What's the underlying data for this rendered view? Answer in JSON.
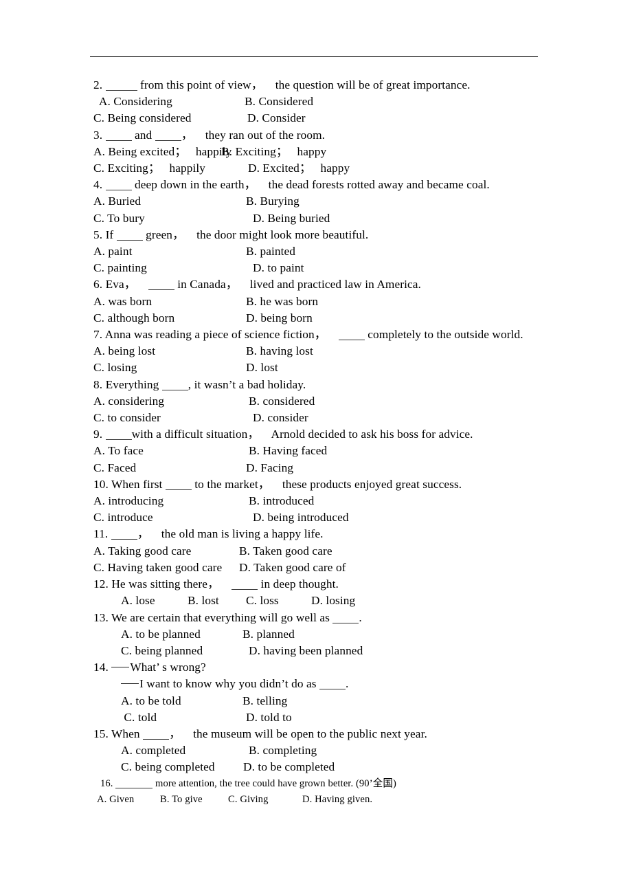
{
  "document": {
    "type": "grammar-worksheet",
    "background_color": "#ffffff",
    "text_color": "#000000",
    "rule": {
      "present": true,
      "color": "#1a1a1a"
    }
  },
  "questions": [
    {
      "number": "2.",
      "stem_before": "2. ",
      "stem_after": " from this point of view，    the question will be of great importance.",
      "stem_full": "2. ____ from this point of view，    the question will be of great importance.",
      "option_a": "A. Considering",
      "option_b": "B. Considered",
      "option_c": "C. Being considered",
      "option_d": "D. Consider"
    },
    {
      "number": "3.",
      "stem_full": "3. ____ and ____，    they ran out of the room.",
      "option_a": "A. Being excited；   happily",
      "option_b": "B. Exciting；   happy",
      "option_c": "C. Exciting；   happily",
      "option_d": "D. Excited；   happy"
    },
    {
      "number": "4.",
      "stem_full": "4. ____ deep down in the earth，    the dead forests rotted away and became coal.",
      "option_a": "A. Buried",
      "option_b": "B. Burying",
      "option_c": "C. To bury",
      "option_d": "D. Being buried"
    },
    {
      "number": "5.",
      "stem_full": "5. If ____ green，    the door might look more beautiful.",
      "option_a": "A. paint",
      "option_b": "B. painted",
      "option_c": "C. painting",
      "option_d": "D. to paint"
    },
    {
      "number": "6.",
      "stem_full": "6. Eva，    ____ in Canada，    lived and practiced law in America.",
      "option_a": "A. was born",
      "option_b": "B. he was born",
      "option_c": "C. although born",
      "option_d": "D. being born"
    },
    {
      "number": "7.",
      "stem_full": "7. Anna was reading a piece of science fiction，    ____ completely to the outside world.",
      "option_a": "A. being lost",
      "option_b": "B. having lost",
      "option_c": "C. losing",
      "option_d": "D. lost"
    },
    {
      "number": "8.",
      "stem_full": "8. Everything ____, it wasn’t a bad holiday.",
      "option_a": "A. considering",
      "option_b": "B. considered",
      "option_c": "C. to consider",
      "option_d": "D. consider"
    },
    {
      "number": "9.",
      "stem_full": "9. ____ with a difficult situation，    Arnold decided to ask his boss for advice.",
      "option_a": "A. To face",
      "option_b": "B. Having faced",
      "option_c": "C. Faced",
      "option_d": "D. Facing"
    },
    {
      "number": "10.",
      "stem_full": "10. When first ____ to the market，    these products enjoyed great success.",
      "option_a": "A. introducing",
      "option_b": "B. introduced",
      "option_c": "C. introduce",
      "option_d": "D. being introduced"
    },
    {
      "number": "11.",
      "stem_full": "11. ____，    the old man is living a happy life.",
      "option_a": "A. Taking good care",
      "option_b": "B. Taken good care",
      "option_c": "C. Having taken good care",
      "option_d": "D. Taken good care of"
    },
    {
      "number": "12.",
      "stem_full": "12. He was sitting there，    ____ in deep thought.",
      "option_a": "A. lose",
      "option_b": "B. lost",
      "option_c": "C. loss",
      "option_d": "D. losing",
      "options_inline": true
    },
    {
      "number": "13.",
      "stem_full": "13. We are certain that everything will go well as ____.",
      "option_a": "A. to be planned",
      "option_b": "B. planned",
      "option_c": "C. being planned",
      "option_d": "D. having been planned"
    },
    {
      "number": "14.",
      "stem_line_1": "14. ——What’ s wrong?",
      "stem_line_2": "——I want to know why you didn’t do as ____.",
      "option_a": "A. to be told",
      "option_b": "B. telling",
      "option_c": "C. told",
      "option_d": "D. told to"
    },
    {
      "number": "15.",
      "stem_full": "15. When ____，    the museum will be open to the public next year.",
      "option_a": "A. completed",
      "option_b": "B. completing",
      "option_c": "C. being completed",
      "option_d": "D. to be completed"
    },
    {
      "number": "16.",
      "stem_full": "16. ______ more attention, the tree could have grown better. (90’全国)",
      "option_a": "A. Given",
      "option_b": "B. To give",
      "option_c": "C. Giving",
      "option_d": "D. Having given.",
      "options_inline": true,
      "small": true
    }
  ],
  "lines": {
    "q2_stem_a": "2. ",
    "q2_stem_b": " from this point of view，    the question will be of great importance.",
    "q2_opts_ab_a": "  A. Considering",
    "q2_opts_ab_b": "B. Considered",
    "q2_opts_cd_c": "C. Being considered",
    "q2_opts_cd_d": "D. Consider",
    "q3_stem_a": "3. ",
    "q3_stem_b": " and ",
    "q3_stem_c": "，    they ran out of the room.",
    "q3_opts_ab_a": "A. Being excited；   happily",
    "q3_opts_ab_b": "B. Exciting；   happy",
    "q3_opts_cd_c": "C. Exciting；   happily",
    "q3_opts_cd_d": "D. Excited；   happy",
    "q4_stem_a": "4. ",
    "q4_stem_b": " deep down in the earth，    the dead forests rotted away and became coal.",
    "q4_opts_ab_a": "A. Buried",
    "q4_opts_ab_b": "B. Burying",
    "q4_opts_cd_c": "C. To bury",
    "q4_opts_cd_d": "D. Being buried",
    "q5_stem_a": "5. If ",
    "q5_stem_b": " green，    the door might look more beautiful.",
    "q5_opts_ab_a": "A. paint",
    "q5_opts_ab_b": "B. painted",
    "q5_opts_cd_c": "C. painting",
    "q5_opts_cd_d": "D. to paint",
    "q6_stem_a": "6. Eva，    ",
    "q6_stem_b": " in Canada，    lived and practiced law in America.",
    "q6_opts_ab_a": "A. was born",
    "q6_opts_ab_b": "B. he was born",
    "q6_opts_cd_c": "C. although born",
    "q6_opts_cd_d": "D. being born",
    "q7_stem_a": "7. Anna was reading a piece of science fiction，    ",
    "q7_stem_b": " completely to the outside world.",
    "q7_opts_ab_a": "A. being lost",
    "q7_opts_ab_b": "B. having lost",
    "q7_opts_cd_c": "C. losing",
    "q7_opts_cd_d": "D. lost",
    "q8_stem_a": "8. Everything ",
    "q8_stem_b": ", it wasn’t a bad holiday.",
    "q8_opts_ab_a": "A. considering",
    "q8_opts_ab_b": "B. considered",
    "q8_opts_cd_c": "C. to consider",
    "q8_opts_cd_d": "D. consider",
    "q9_stem_a": "9. ",
    "q9_stem_b": "with a difficult situation，    Arnold decided to ask his boss for advice.",
    "q9_opts_ab_a": "A. To face",
    "q9_opts_ab_b": "B. Having faced",
    "q9_opts_cd_c": "C. Faced",
    "q9_opts_cd_d": "D. Facing",
    "q10_stem_a": "10. When first ",
    "q10_stem_b": " to the market，    these products enjoyed great success.",
    "q10_opts_ab_a": "A. introducing",
    "q10_opts_ab_b": "B. introduced",
    "q10_opts_cd_c": "C. introduce",
    "q10_opts_cd_d": "D. being introduced",
    "q11_stem_a": "11. ",
    "q11_stem_b": "，    the old man is living a happy life.",
    "q11_opts_ab_a": "A. Taking good care",
    "q11_opts_ab_b": "B. Taken good care",
    "q11_opts_cd_c": "C. Having taken good care",
    "q11_opts_cd_d": "D. Taken good care of",
    "q12_stem_a": "12. He was sitting there，    ",
    "q12_stem_b": " in deep thought.",
    "q12_opt_a": "A. lose",
    "q12_opt_b": "B. lost",
    "q12_opt_c": "C. loss",
    "q12_opt_d": "D. losing",
    "q13_stem_a": "13. We are certain that everything will go well as ",
    "q13_stem_b": ".",
    "q13_opts_ab_a": "A. to be planned",
    "q13_opts_ab_b": "B. planned",
    "q13_opts_cd_c": "C. being planned",
    "q13_opts_cd_d": "D. having been planned",
    "q14_stem_1a": "14. ",
    "q14_stem_1b": "What’ s wrong?",
    "q14_stem_2b": "I want to know why you didn’t do as ",
    "q14_stem_2c": ".",
    "q14_opts_ab_a": "A. to be told",
    "q14_opts_ab_b": "B. telling",
    "q14_opts_cd_c": " C. told",
    "q14_opts_cd_d": "D. told to",
    "q15_stem_a": "15. When ",
    "q15_stem_b": "，    the museum will be open to the public next year.",
    "q15_opts_ab_a": "A. completed",
    "q15_opts_ab_b": "B. completing",
    "q15_opts_cd_c": "C. being completed",
    "q15_opts_cd_d": "D. to be completed",
    "q16_stem_a": "16. ",
    "q16_stem_b": " more attention, the tree could have grown better. (90’全国)",
    "q16_opt_a": "A. Given",
    "q16_opt_b": "B. To give",
    "q16_opt_c": "C. Giving",
    "q16_opt_d": "D. Having given."
  }
}
